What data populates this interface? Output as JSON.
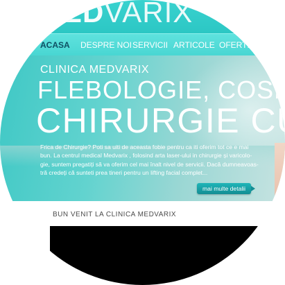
{
  "header": {
    "brand_bold": "MED",
    "brand_light": "VARIX"
  },
  "nav": {
    "items": [
      {
        "label": "ACASA"
      },
      {
        "label": "DESPRE NOI"
      },
      {
        "label": "SERVICII"
      },
      {
        "label": "ARTICOLE"
      },
      {
        "label": "OFERTE"
      }
    ]
  },
  "hero": {
    "kicker": "CLINICA MEDVARIX",
    "headline1": "FLEBOLOGIE, COSMETIC",
    "headline2": "CHIRURGIE CU",
    "intro_lines": [
      "Frica de Chirurgie? Poti sa uiti de aceasta fobie pentru ca iti oferim tot ce e mai",
      "bun. La centrul medical Medvarix , folosind arta laser-ului in chirurgie și varicolo-",
      "gie, suntem pregatiți să va oferim cel mai înalt nivel de servicii. Dacă dumneavoas-",
      "tră credeți că sunteti prea tineri pentru un lifting facial complet..."
    ],
    "more_label": "mai multe detalii"
  },
  "welcome": {
    "title": "BUN VENIT LA CLINICA MEDVARIX"
  },
  "colors": {
    "accent": "#39d2cf",
    "nav_bg": "#48d6d2",
    "button": "#138d93",
    "active_nav_text": "#0e4f63"
  }
}
